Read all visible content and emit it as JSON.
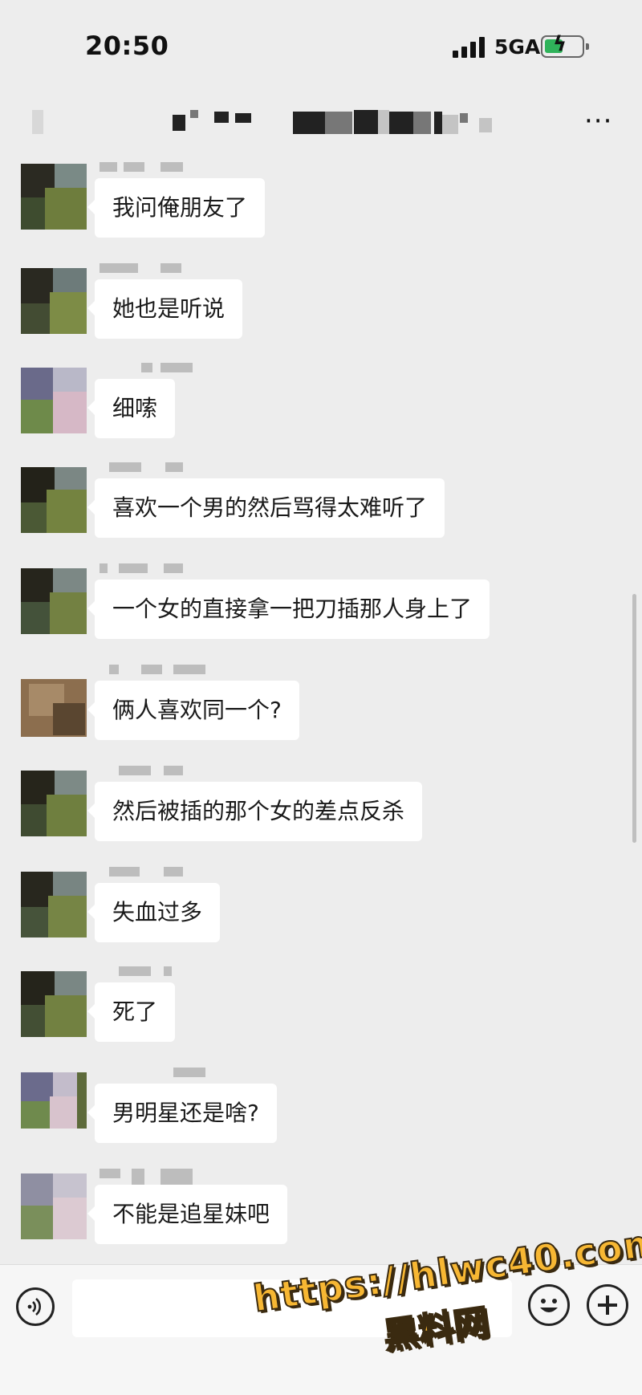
{
  "status_bar": {
    "time": "20:50",
    "network": "5GA"
  },
  "nav": {
    "more_icon": "more-horiz-icon",
    "more_label": "···"
  },
  "messages": [
    {
      "text": "我问俺朋友了",
      "avatar": "green-avatar"
    },
    {
      "text": "她也是听说",
      "avatar": "green-avatar"
    },
    {
      "text": "细嗦",
      "avatar": "pink-avatar"
    },
    {
      "text": "喜欢一个男的然后骂得太难听了",
      "avatar": "green-avatar"
    },
    {
      "text": "一个女的直接拿一把刀插那人身上了",
      "avatar": "green-avatar"
    },
    {
      "text": "俩人喜欢同一个?",
      "avatar": "tan-avatar"
    },
    {
      "text": "然后被插的那个女的差点反杀",
      "avatar": "green-avatar"
    },
    {
      "text": "失血过多",
      "avatar": "green-avatar"
    },
    {
      "text": "死了",
      "avatar": "green-avatar"
    },
    {
      "text": "男明星还是啥?",
      "avatar": "pink-avatar"
    },
    {
      "text": "不能是追星妹吧",
      "avatar": "pink-avatar"
    }
  ],
  "input_bar": {
    "voice_icon": "voice-icon",
    "emoji_icon": "emoji-icon",
    "plus_icon": "plus-icon"
  },
  "watermark": {
    "url": "https://hlwc40.com",
    "name": "黑料网"
  }
}
